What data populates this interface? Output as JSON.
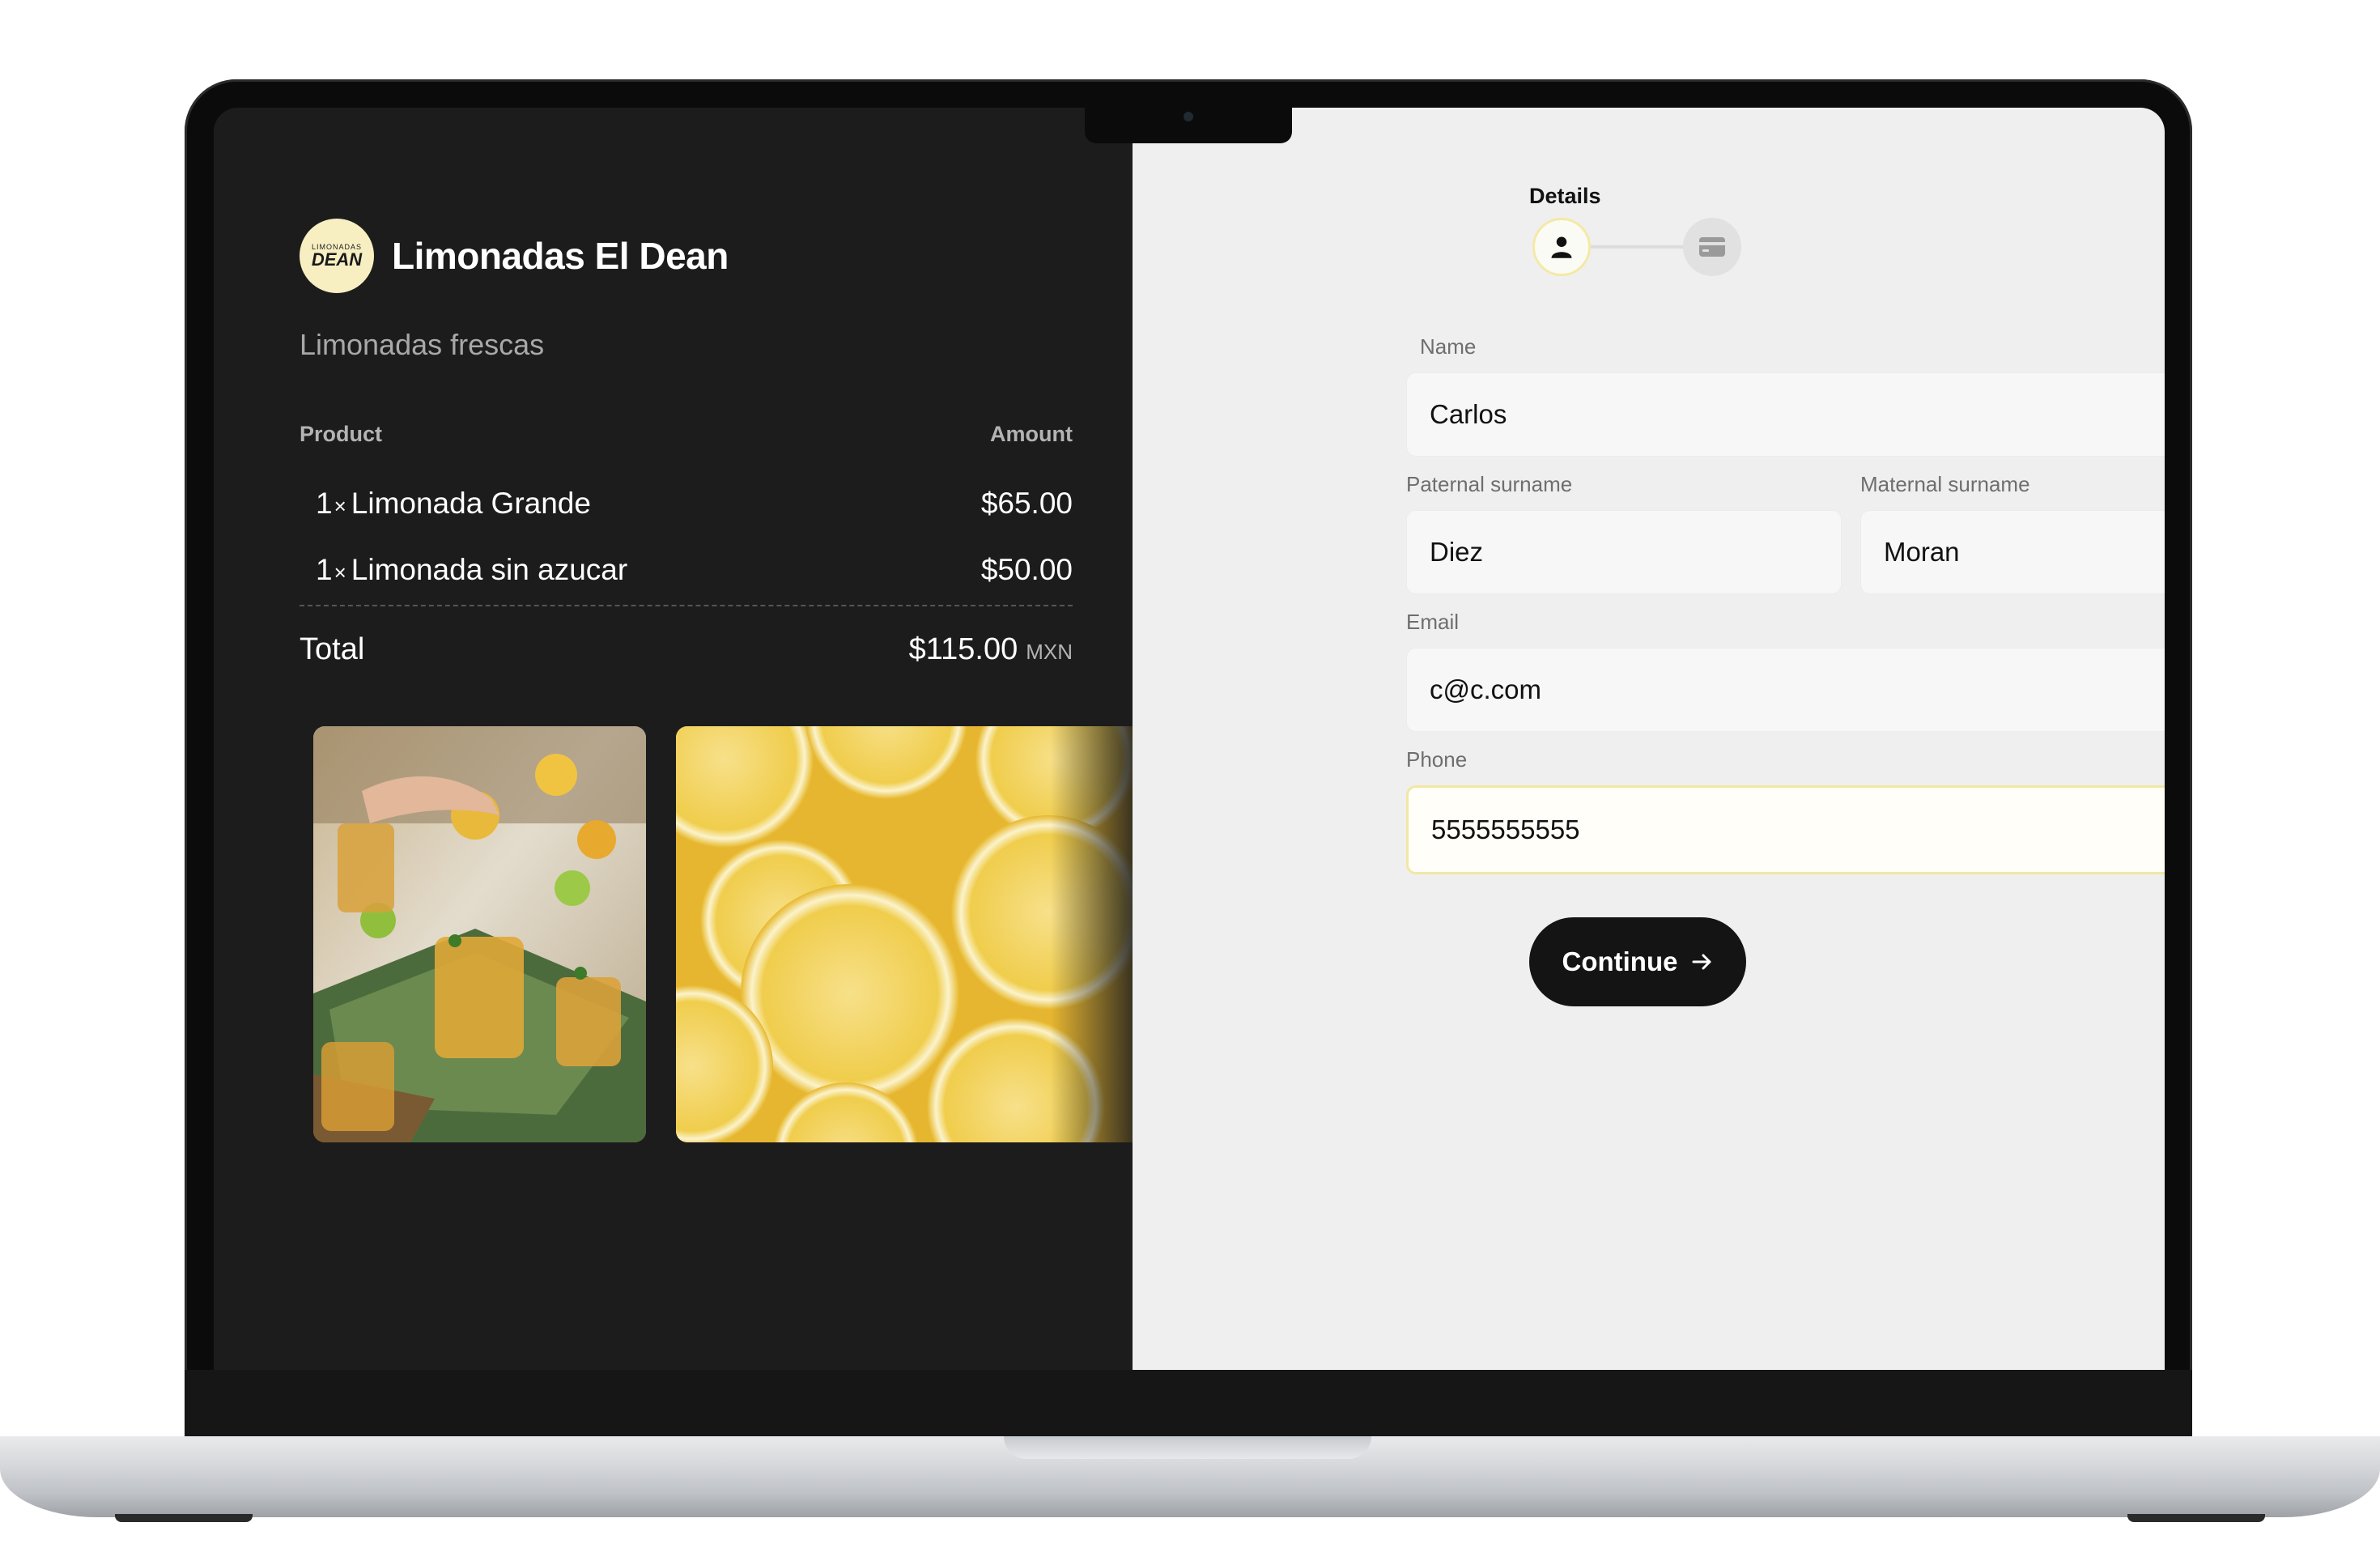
{
  "brand": {
    "logo_small": "LIMONADAS",
    "logo_big": "DEAN",
    "name": "Limonadas El Dean",
    "tagline": "Limonadas frescas"
  },
  "order": {
    "col_product": "Product",
    "col_amount": "Amount",
    "items": [
      {
        "qty": "1",
        "x": "×",
        "name": "Limonada Grande",
        "amount": "$65.00"
      },
      {
        "qty": "1",
        "x": "×",
        "name": "Limonada sin azucar",
        "amount": "$50.00"
      }
    ],
    "total_label": "Total",
    "total_value": "$115.00",
    "currency": "MXN"
  },
  "stepper": {
    "current_label": "Details",
    "step1_icon": "person-icon",
    "step2_icon": "credit-card-icon"
  },
  "form": {
    "name_label": "Name",
    "name_value": "Carlos",
    "paternal_label": "Paternal surname",
    "paternal_value": "Diez",
    "maternal_label": "Maternal surname",
    "maternal_value": "Moran",
    "email_label": "Email",
    "email_value": "c@c.com",
    "phone_label": "Phone",
    "phone_value": "5555555555",
    "continue_label": "Continue"
  },
  "colors": {
    "left_bg": "#1c1c1c",
    "right_bg": "#efefef",
    "accent_yellow": "#f2e7a3",
    "button_bg": "#141414"
  }
}
